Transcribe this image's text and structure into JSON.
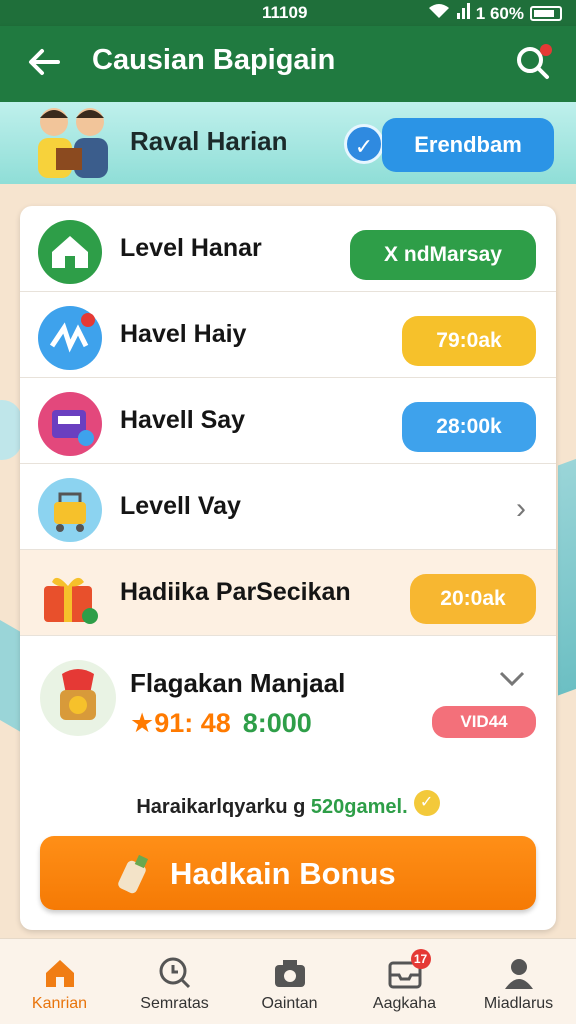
{
  "status": {
    "time": "11109",
    "battery": "1 60%"
  },
  "appbar": {
    "title": "Causian Bapigain"
  },
  "banner": {
    "title": "Raval Harian",
    "button": "Erendbam"
  },
  "rows": [
    {
      "label": "Level Hanar",
      "badge": "X ndMarsay",
      "color": "#2e9e48"
    },
    {
      "label": "Havel Haiy",
      "badge": "79:0ak",
      "color": "#f6c12b"
    },
    {
      "label": "Havell Say",
      "badge": "28:00k",
      "color": "#3ea2ec"
    },
    {
      "label": "Levell Vay"
    },
    {
      "label": "Hadiika ParSecikan",
      "badge": "20:0ak",
      "color": "#f7b731"
    }
  ],
  "flag": {
    "title": "Flagakan Manjaal",
    "score_a": "★91: 48",
    "score_b": "8:000",
    "vip": "VID44"
  },
  "note": {
    "text_a": "Haraikarlqyarku g ",
    "text_b": "520gamel."
  },
  "bonus": {
    "label": "Hadkain Bonus"
  },
  "nav": [
    {
      "label": "Kanrian",
      "icon": "home-icon"
    },
    {
      "label": "Semratas",
      "icon": "clock-search-icon"
    },
    {
      "label": "Oaintan",
      "icon": "camera-icon"
    },
    {
      "label": "Aagkaha",
      "icon": "inbox-icon",
      "badge": "17"
    },
    {
      "label": "Miadlarus",
      "icon": "profile-icon"
    }
  ]
}
